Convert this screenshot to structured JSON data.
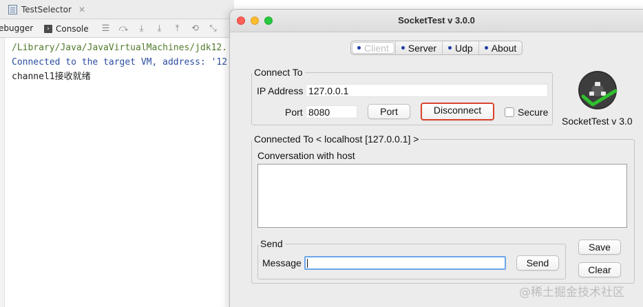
{
  "ide": {
    "file_tab": "TestSelector",
    "toolbar": {
      "debugger_label": "ebugger",
      "console_label": "Console"
    },
    "console_lines": [
      "/Library/Java/JavaVirtualMachines/jdk12.",
      "Connected to the target VM, address: '12",
      "channel1接收就绪"
    ]
  },
  "window": {
    "title": "SocketTest v 3.0.0",
    "tabs": [
      "Client",
      "Server",
      "Udp",
      "About"
    ],
    "active_tab": "Client"
  },
  "connect": {
    "legend": "Connect To",
    "ip_label": "IP Address",
    "ip_value": "127.0.0.1",
    "port_label": "Port",
    "port_value": "8080",
    "port_button": "Port",
    "disconnect_button": "Disconnect",
    "secure_label": "Secure",
    "secure_checked": false
  },
  "logo": {
    "caption": "SocketTest v 3.0"
  },
  "connected": {
    "legend": "Connected To <  localhost [127.0.0.1]  >",
    "conversation_label": "Conversation with host",
    "conversation_text": ""
  },
  "send": {
    "legend": "Send",
    "message_label": "Message",
    "message_value": "",
    "send_button": "Send"
  },
  "side_buttons": {
    "save": "Save",
    "clear": "Clear"
  },
  "watermark": "@稀土掘金技术社区",
  "colors": {
    "highlight_border": "#d9432c",
    "input_focus": "#6aa6ea",
    "logo_green": "#2fbf2f"
  }
}
